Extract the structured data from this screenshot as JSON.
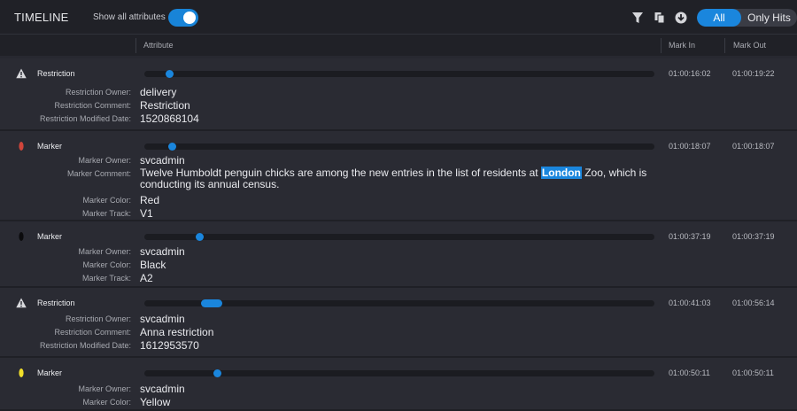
{
  "header": {
    "title": "TIMELINE",
    "show_all_label": "Show all attributes",
    "toggle_on": true,
    "icons": [
      "filter-icon",
      "copy-icon",
      "download-icon"
    ],
    "segment": {
      "all_label": "All",
      "hits_label": "Only Hits",
      "selected": "All"
    }
  },
  "columns": {
    "attribute": "Attribute",
    "mark_in": "Mark In",
    "mark_out": "Mark Out"
  },
  "accent_color": "#1a86dd",
  "entries": [
    {
      "type": "Restriction",
      "icon": "warning-icon",
      "mark_in": "01:00:16:02",
      "mark_out": "01:00:19:22",
      "attributes": [
        {
          "key": "Restriction Owner:",
          "value": "delivery"
        },
        {
          "key": "Restriction Comment:",
          "value": "Restriction"
        },
        {
          "key": "Restriction Modified Date:",
          "value": "1520868104"
        }
      ]
    },
    {
      "type": "Marker",
      "icon": "marker-dot-icon",
      "color": "#d0453b",
      "mark_in": "01:00:18:07",
      "mark_out": "01:00:18:07",
      "attributes": [
        {
          "key": "Marker Owner:",
          "value": "svcadmin"
        },
        {
          "key": "Marker Comment:",
          "value_before": "Twelve Humboldt penguin chicks are among the new entries in the list of residents at ",
          "value_highlight": "London",
          "value_after": " Zoo, which is conducting its annual census."
        },
        {
          "key": "Marker Color:",
          "value": "Red"
        },
        {
          "key": "Marker Track:",
          "value": "V1"
        }
      ]
    },
    {
      "type": "Marker",
      "icon": "marker-dot-icon",
      "color": "#0b0b0d",
      "mark_in": "01:00:37:19",
      "mark_out": "01:00:37:19",
      "attributes": [
        {
          "key": "Marker Owner:",
          "value": "svcadmin"
        },
        {
          "key": "Marker Color:",
          "value": "Black"
        },
        {
          "key": "Marker Track:",
          "value": "A2"
        }
      ]
    },
    {
      "type": "Restriction",
      "icon": "warning-icon",
      "mark_in": "01:00:41:03",
      "mark_out": "01:00:56:14",
      "attributes": [
        {
          "key": "Restriction Owner:",
          "value": "svcadmin"
        },
        {
          "key": "Restriction Comment:",
          "value": "Anna restriction"
        },
        {
          "key": "Restriction Modified Date:",
          "value": "1612953570"
        }
      ]
    },
    {
      "type": "Marker",
      "icon": "marker-dot-icon",
      "color": "#f2e02a",
      "mark_in": "01:00:50:11",
      "mark_out": "01:00:50:11",
      "attributes": [
        {
          "key": "Marker Owner:",
          "value": "svcadmin"
        },
        {
          "key": "Marker Color:",
          "value": "Yellow"
        }
      ]
    }
  ]
}
